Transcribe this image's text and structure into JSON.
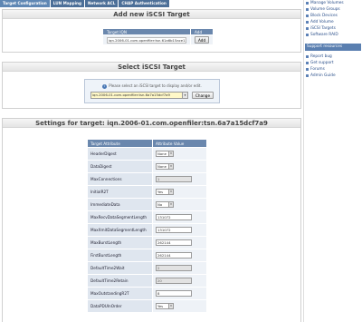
{
  "tabs": [
    "Target Configuration",
    "LUN Mapping",
    "Network ACL",
    "CHAP Authentication"
  ],
  "add_target": {
    "title": "Add new iSCSI Target",
    "col_iqn": "Target IQN",
    "col_add": "Add",
    "iqn_value": "iqn.2006-01.com.openfiler:tsn.61a6b15ace13",
    "add_button": "Add"
  },
  "select_target": {
    "title": "Select iSCSI Target",
    "message": "Please select an iSCSI target to display and/or edit.",
    "selected": "iqn.2006-01.com.openfiler:tsn.6a7a15dcf7a9",
    "change_button": "Change"
  },
  "settings": {
    "title": "Settings for target: iqn.2006-01.com.openfiler:tsn.6a7a15dcf7a9",
    "col_attr": "Target Attribute",
    "col_value": "Attribute Value",
    "rows": [
      {
        "attr": "HeaderDigest",
        "type": "select",
        "value": "None"
      },
      {
        "attr": "DataDigest",
        "type": "select",
        "value": "None"
      },
      {
        "attr": "MaxConnections",
        "type": "text-disabled",
        "value": "1"
      },
      {
        "attr": "InitialR2T",
        "type": "select",
        "value": "Yes"
      },
      {
        "attr": "ImmediateData",
        "type": "select",
        "value": "No"
      },
      {
        "attr": "MaxRecvDataSegmentLength",
        "type": "text",
        "value": "131072"
      },
      {
        "attr": "MaxXmitDataSegmentLength",
        "type": "text",
        "value": "131072"
      },
      {
        "attr": "MaxBurstLength",
        "type": "text",
        "value": "262144"
      },
      {
        "attr": "FirstBurstLength",
        "type": "text",
        "value": "262144"
      },
      {
        "attr": "DefaultTime2Wait",
        "type": "text-disabled",
        "value": "2"
      },
      {
        "attr": "DefaultTime2Retain",
        "type": "text-disabled",
        "value": "20"
      },
      {
        "attr": "MaxOutstandingR2T",
        "type": "text",
        "value": "8"
      },
      {
        "attr": "DataPDUInOrder",
        "type": "select",
        "value": "Yes"
      }
    ]
  },
  "sidebar": {
    "links": [
      "Manage Volumes",
      "Volume Groups",
      "Block Devices",
      "Add Volume",
      "iSCSI Targets",
      "Software RAID"
    ],
    "support_title": "Support resources",
    "support_links": [
      "Report bug",
      "Get support",
      "Forums",
      "Admin Guide"
    ]
  }
}
